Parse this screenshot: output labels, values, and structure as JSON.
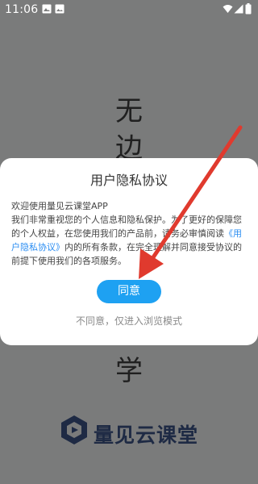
{
  "status_bar": {
    "time": "11:06",
    "icons": [
      "gallery-icon",
      "image-icon",
      "wifi-icon",
      "signal-icon",
      "battery-icon"
    ]
  },
  "splash": {
    "chars": [
      "无",
      "边",
      "学"
    ],
    "logo_text": "量见云课堂"
  },
  "dialog": {
    "title": "用户隐私协议",
    "body_line1": "欢迎使用量见云课堂APP",
    "body_part1": "我们非常重视您的个人信息和隐私保护。为了更好的保障您的个人权益，在您使用我们的产品前，请务必审慎阅读",
    "body_link": "《用户隐私协议》",
    "body_part2": "内的所有条款，在完全理解并同意接受协议的前提下使用我们的各项服务。",
    "agree_label": "同意",
    "disagree_label": "不同意，仅进入浏览模式"
  },
  "colors": {
    "accent": "#1ea1f2",
    "link": "#2a8df2",
    "overlay": "#7a7b7b",
    "annotation_arrow": "#e03a2e"
  }
}
